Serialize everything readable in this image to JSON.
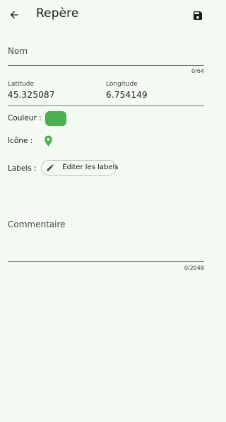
{
  "app_bar": {
    "title": "Repère",
    "back_icon": "arrow-back-icon",
    "save_icon": "save-icon"
  },
  "name_field": {
    "label": "Nom",
    "value": "",
    "counter": "0/64"
  },
  "coordinates": {
    "latitude_label": "Latitude",
    "latitude_value": "45.325087",
    "longitude_label": "Longitude",
    "longitude_value": "6.754149"
  },
  "color_row": {
    "label": "Couleur :",
    "color": "#4caf50"
  },
  "icon_row": {
    "label": "Icône :",
    "icon": "location-pin-icon",
    "color": "#4caf50"
  },
  "labels_row": {
    "label": "Labels :",
    "button_label": "Éditer les labels",
    "button_icon": "pencil-icon"
  },
  "comment_field": {
    "label": "Commentaire",
    "value": "",
    "counter": "0/2048"
  },
  "colors": {
    "background": "#f3faf2",
    "accent": "#4caf50",
    "text": "#1a1c19",
    "text_secondary": "#42493f",
    "divider": "#72796f"
  }
}
